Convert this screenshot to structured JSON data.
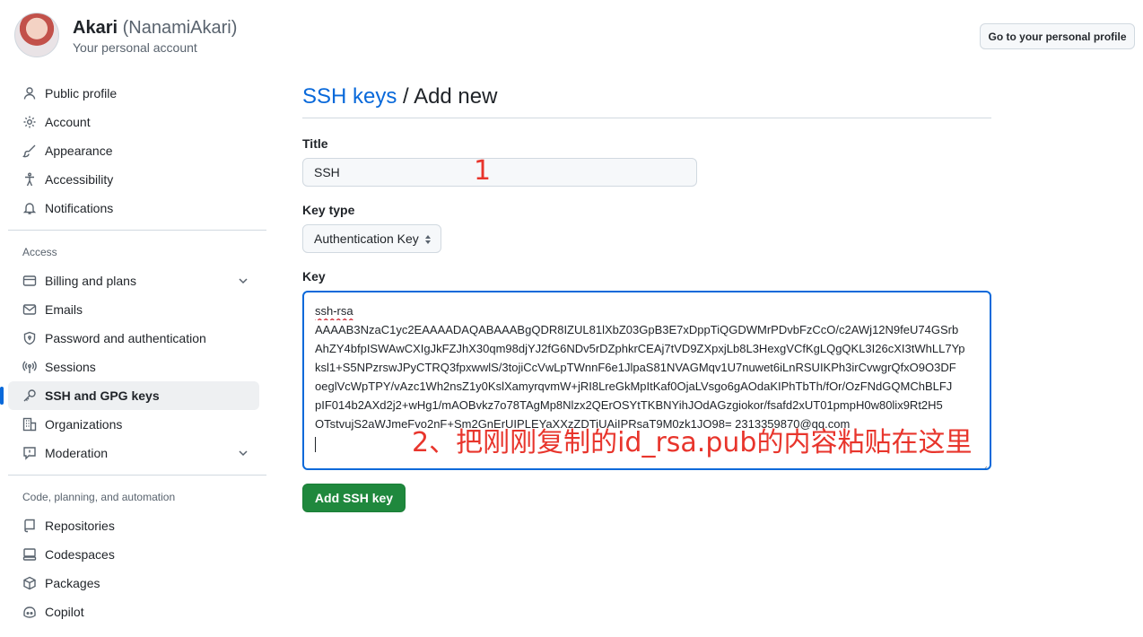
{
  "header": {
    "display_name": "Akari",
    "username": "(NanamiAkari)",
    "subtitle": "Your personal account",
    "profile_button": "Go to your personal profile"
  },
  "sidebar": {
    "top_items": [
      {
        "label": "Public profile",
        "icon": "person-icon"
      },
      {
        "label": "Account",
        "icon": "gear-icon"
      },
      {
        "label": "Appearance",
        "icon": "paintbrush-icon"
      },
      {
        "label": "Accessibility",
        "icon": "accessibility-icon"
      },
      {
        "label": "Notifications",
        "icon": "bell-icon"
      }
    ],
    "access_title": "Access",
    "access_items": [
      {
        "label": "Billing and plans",
        "icon": "credit-card-icon"
      },
      {
        "label": "Emails",
        "icon": "mail-icon"
      },
      {
        "label": "Password and authentication",
        "icon": "shield-lock-icon"
      },
      {
        "label": "Sessions",
        "icon": "broadcast-icon"
      },
      {
        "label": "SSH and GPG keys",
        "icon": "key-icon"
      },
      {
        "label": "Organizations",
        "icon": "organization-icon"
      },
      {
        "label": "Moderation",
        "icon": "report-icon"
      }
    ],
    "code_title": "Code, planning, and automation",
    "code_items": [
      {
        "label": "Repositories",
        "icon": "repo-icon"
      },
      {
        "label": "Codespaces",
        "icon": "codespaces-icon"
      },
      {
        "label": "Packages",
        "icon": "package-icon"
      },
      {
        "label": "Copilot",
        "icon": "copilot-icon"
      }
    ]
  },
  "main": {
    "breadcrumb_link": "SSH keys",
    "breadcrumb_separator": " / ",
    "breadcrumb_current": "Add new",
    "title_label": "Title",
    "title_value": "SSH",
    "key_type_label": "Key type",
    "key_type_value": "Authentication Key",
    "key_label": "Key",
    "key_lines": [
      "ssh-rsa",
      "AAAAB3NzaC1yc2EAAAADAQABAAABgQDR8IZUL81lXbZ03GpB3E7xDppTiQGDWMrPDvbFzCcO/c2AWj12N9feU74GSrb",
      "AhZY4bfpISWAwCXIgJkFZJhX30qm98djYJ2fG6NDv5rDZphkrCEAj7tVD9ZXpxjLb8L3HexgVCfKgLQgQKL3I26cXI3tWhLL7Yp",
      "ksl1+S5NPzrswJPyCTRQ3fpxwwlS/3tojiCcVwLpTWnnF6e1JlpaS81NVAGMqv1U7nuwet6iLnRSUIKPh3irCvwgrQfxO9O3DF",
      "oeglVcWpTPY/vAzc1Wh2nsZ1y0KslXamyrqvmW+jRI8LreGkMpItKaf0OjaLVsgo6gAOdaKIPhTbTh/fOr/OzFNdGQMChBLFJ",
      "pIF014b2AXd2j2+wHg1/mAOBvkz7o78TAgMp8Nlzx2QErOSYtTKBNYihJOdAGzgiokor/fsafd2xUT01pmpH0w80lix9Rt2H5",
      "OTstvujS2aWJmeFvo2nF+Sm2GnErUIPLEYaXXzZDTiUAiIPRsaT9M0zk1JO98= 2313359870@qq.com"
    ],
    "add_button": "Add SSH key"
  },
  "annotations": {
    "step1": "1",
    "step2": "2、把刚刚复制的id_rsa.pub的内容粘贴在这里"
  },
  "colors": {
    "accent": "#0969da",
    "primary_button": "#1f883d",
    "annotation": "#e8352c"
  }
}
